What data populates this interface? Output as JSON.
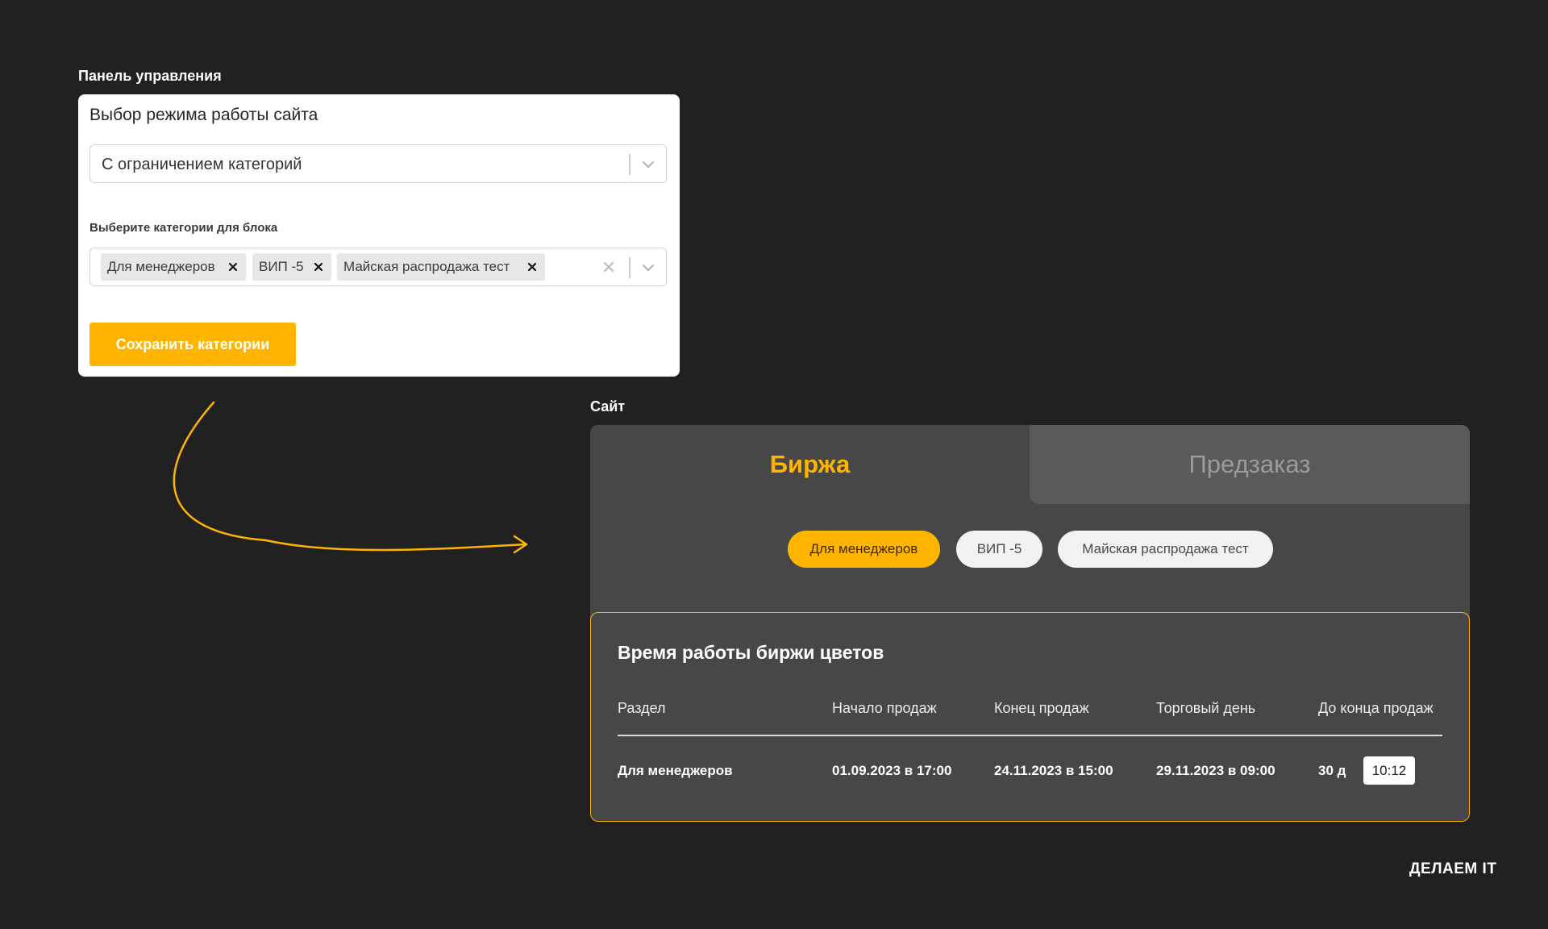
{
  "admin": {
    "section_label": "Панель управления",
    "mode_label": "Выбор режима работы сайта",
    "mode_value": "С ограничением категорий",
    "categories_label": "Выберите категории для блока",
    "selected_tags": [
      "Для менеджеров",
      "ВИП -5",
      "Майская распродажа тест"
    ],
    "save_label": "Сохранить категории",
    "icons": {
      "dropdown": "chevron-down-icon",
      "clear": "close-icon",
      "remove_tag": "close-icon"
    }
  },
  "site": {
    "section_label": "Сайт",
    "tabs": [
      {
        "label": "Биржа",
        "active": true
      },
      {
        "label": "Предзаказ",
        "active": false
      }
    ],
    "category_pills": [
      {
        "label": "Для менеджеров",
        "active": true
      },
      {
        "label": "ВИП -5",
        "active": false
      },
      {
        "label": "Майская распродажа тест",
        "active": false
      }
    ],
    "schedule": {
      "title": "Время работы биржи цветов",
      "columns": [
        "Раздел",
        "Начало продаж",
        "Конец продаж",
        "Торговый день",
        "До конца продаж"
      ],
      "rows": [
        {
          "section": "Для менеджеров",
          "start": "01.09.2023 в 17:00",
          "end": "24.11.2023 в 15:00",
          "trade_day": "29.11.2023 в 09:00",
          "days_left": "30 д",
          "time_left": "10:12"
        }
      ]
    }
  },
  "logo": "ДЕЛАЕМ IT",
  "colors": {
    "background": "#212121",
    "accent": "#ffb400",
    "panel": "#ffffff",
    "widget": "#474747",
    "inactive_tab": "#5a5a5a"
  }
}
